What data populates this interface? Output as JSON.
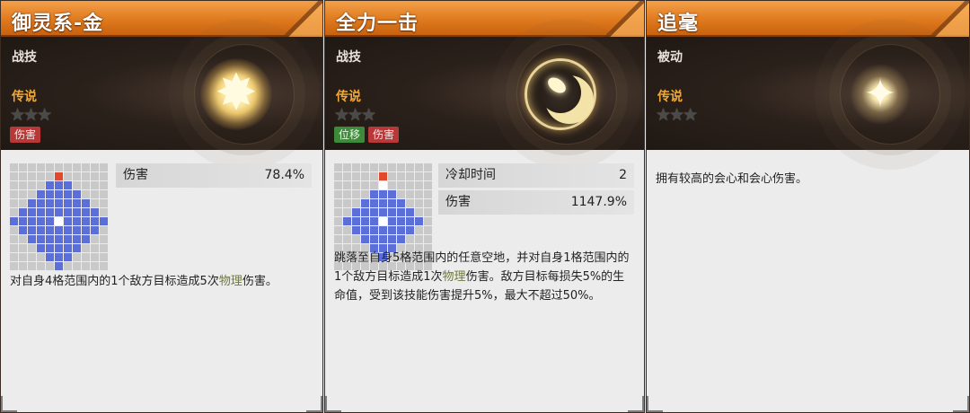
{
  "cards": [
    {
      "title": "御灵系-金",
      "type": "战技",
      "rarity": "传说",
      "stars": [
        "★",
        "★",
        "★"
      ],
      "tags": [
        "伤害"
      ],
      "icon": "golden-burst-icon",
      "stats": [
        {
          "label": "伤害",
          "value": "78.4%"
        }
      ],
      "desc_parts": [
        "对自身4格范围内的1个敌方目标造成5次",
        "物理",
        "伤害。"
      ]
    },
    {
      "title": "全力一击",
      "type": "战技",
      "rarity": "传说",
      "stars": [
        "★",
        "★",
        "★"
      ],
      "tags": [
        "位移",
        "伤害"
      ],
      "icon": "crescent-strike-icon",
      "stats": [
        {
          "label": "冷却时间",
          "value": "2"
        },
        {
          "label": "伤害",
          "value": "1147.9%"
        }
      ],
      "desc_parts": [
        "跳落至自身5格范围内的任意空地，并对自身1格范围内的1个敌方目标造成1次",
        "物理",
        "伤害。敌方目标每损失5%的生命值，受到该技能伤害提升5%，最大不超过50%。"
      ]
    },
    {
      "title": "追毫",
      "type": "被动",
      "rarity": "传说",
      "stars": [
        "★",
        "★",
        "★"
      ],
      "tags": [],
      "icon": "sparkle-star-icon",
      "stats": [],
      "desc_parts": [
        "拥有较高的会心和会心伤害。"
      ]
    }
  ],
  "colors": {
    "title_bar": "#e07a20",
    "rarity": "#f0a838",
    "range_cell": "#5c6fd8",
    "target_cell": "#e0492e",
    "tag_damage": "#b83838",
    "tag_move": "#3d8a3a",
    "keyword": "#6e7a38"
  }
}
